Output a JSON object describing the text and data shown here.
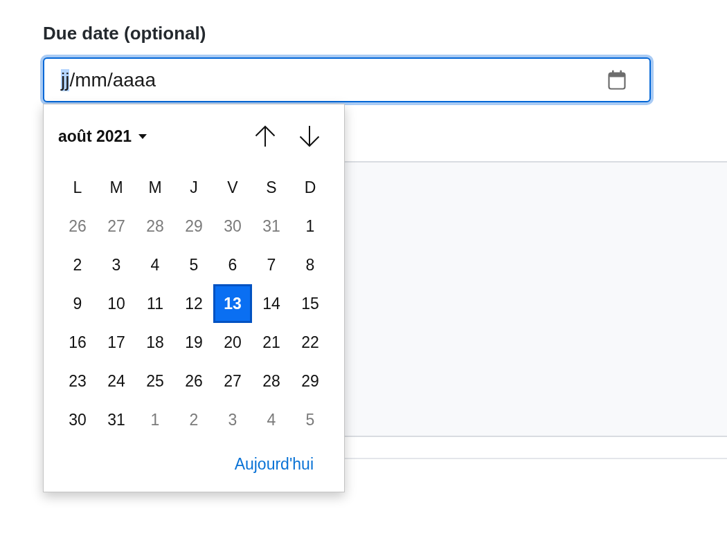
{
  "date_field": {
    "label": "Due date (optional)",
    "focused": true,
    "segments": [
      {
        "kind": "segment",
        "text": "jj",
        "selected": true
      },
      {
        "kind": "separator",
        "text": "/"
      },
      {
        "kind": "segment",
        "text": "mm",
        "selected": false
      },
      {
        "kind": "separator",
        "text": "/"
      },
      {
        "kind": "segment",
        "text": "aaaa",
        "selected": false
      }
    ]
  },
  "date_picker": {
    "month_label": "août 2021",
    "weekdays": [
      "L",
      "M",
      "M",
      "J",
      "V",
      "S",
      "D"
    ],
    "weeks": [
      [
        {
          "day": "26",
          "other_month": true,
          "selected": false
        },
        {
          "day": "27",
          "other_month": true,
          "selected": false
        },
        {
          "day": "28",
          "other_month": true,
          "selected": false
        },
        {
          "day": "29",
          "other_month": true,
          "selected": false
        },
        {
          "day": "30",
          "other_month": true,
          "selected": false
        },
        {
          "day": "31",
          "other_month": true,
          "selected": false
        },
        {
          "day": "1",
          "other_month": false,
          "selected": false
        }
      ],
      [
        {
          "day": "2",
          "other_month": false,
          "selected": false
        },
        {
          "day": "3",
          "other_month": false,
          "selected": false
        },
        {
          "day": "4",
          "other_month": false,
          "selected": false
        },
        {
          "day": "5",
          "other_month": false,
          "selected": false
        },
        {
          "day": "6",
          "other_month": false,
          "selected": false
        },
        {
          "day": "7",
          "other_month": false,
          "selected": false
        },
        {
          "day": "8",
          "other_month": false,
          "selected": false
        }
      ],
      [
        {
          "day": "9",
          "other_month": false,
          "selected": false
        },
        {
          "day": "10",
          "other_month": false,
          "selected": false
        },
        {
          "day": "11",
          "other_month": false,
          "selected": false
        },
        {
          "day": "12",
          "other_month": false,
          "selected": false
        },
        {
          "day": "13",
          "other_month": false,
          "selected": true
        },
        {
          "day": "14",
          "other_month": false,
          "selected": false
        },
        {
          "day": "15",
          "other_month": false,
          "selected": false
        }
      ],
      [
        {
          "day": "16",
          "other_month": false,
          "selected": false
        },
        {
          "day": "17",
          "other_month": false,
          "selected": false
        },
        {
          "day": "18",
          "other_month": false,
          "selected": false
        },
        {
          "day": "19",
          "other_month": false,
          "selected": false
        },
        {
          "day": "20",
          "other_month": false,
          "selected": false
        },
        {
          "day": "21",
          "other_month": false,
          "selected": false
        },
        {
          "day": "22",
          "other_month": false,
          "selected": false
        }
      ],
      [
        {
          "day": "23",
          "other_month": false,
          "selected": false
        },
        {
          "day": "24",
          "other_month": false,
          "selected": false
        },
        {
          "day": "25",
          "other_month": false,
          "selected": false
        },
        {
          "day": "26",
          "other_month": false,
          "selected": false
        },
        {
          "day": "27",
          "other_month": false,
          "selected": false
        },
        {
          "day": "28",
          "other_month": false,
          "selected": false
        },
        {
          "day": "29",
          "other_month": false,
          "selected": false
        }
      ],
      [
        {
          "day": "30",
          "other_month": false,
          "selected": false
        },
        {
          "day": "31",
          "other_month": false,
          "selected": false
        },
        {
          "day": "1",
          "other_month": true,
          "selected": false
        },
        {
          "day": "2",
          "other_month": true,
          "selected": false
        },
        {
          "day": "3",
          "other_month": true,
          "selected": false
        },
        {
          "day": "4",
          "other_month": true,
          "selected": false
        },
        {
          "day": "5",
          "other_month": true,
          "selected": false
        }
      ]
    ],
    "today_button": "Aujourd'hui"
  }
}
